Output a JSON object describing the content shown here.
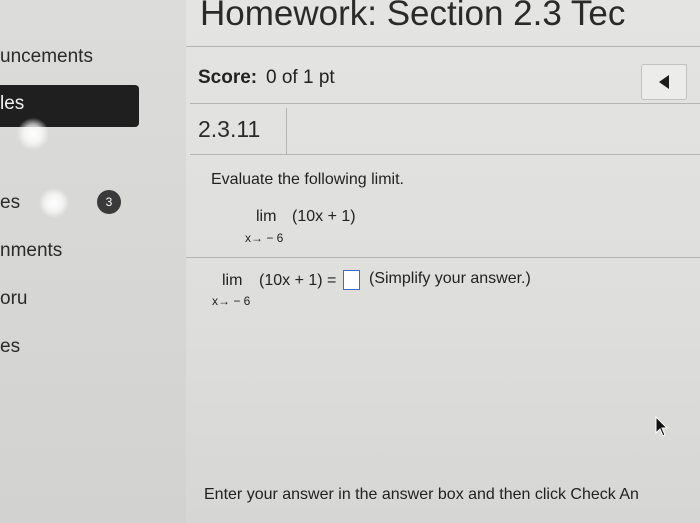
{
  "sidebar": {
    "items": [
      {
        "label": "uncements"
      },
      {
        "label": "les"
      },
      {
        "label": "es",
        "badge": "3"
      },
      {
        "label": "nments"
      },
      {
        "label": "oru"
      },
      {
        "label": "es"
      }
    ]
  },
  "header": {
    "title": "Homework: Section 2.3 Tec"
  },
  "score": {
    "label": "Score:",
    "value": "0 of 1 pt"
  },
  "navigation": {
    "previous_icon": "triangle-left-icon"
  },
  "question": {
    "number": "2.3.11",
    "prompt": "Evaluate the following limit.",
    "expression": {
      "lim": "lim",
      "function": "(10x + 1)",
      "subscript": "x→ − 6"
    },
    "answer_row": {
      "lim": "lim",
      "function_eq": "(10x + 1) =",
      "subscript": "x→ − 6",
      "answer_value": "",
      "hint": "(Simplify your answer.)"
    }
  },
  "footer": {
    "instructions": "Enter your answer in the answer box and then click Check An"
  },
  "colors": {
    "answer_box_border": "#3d6dc8",
    "active_sidebar": "#1f1f1f",
    "badge": "#3a3a3a"
  }
}
